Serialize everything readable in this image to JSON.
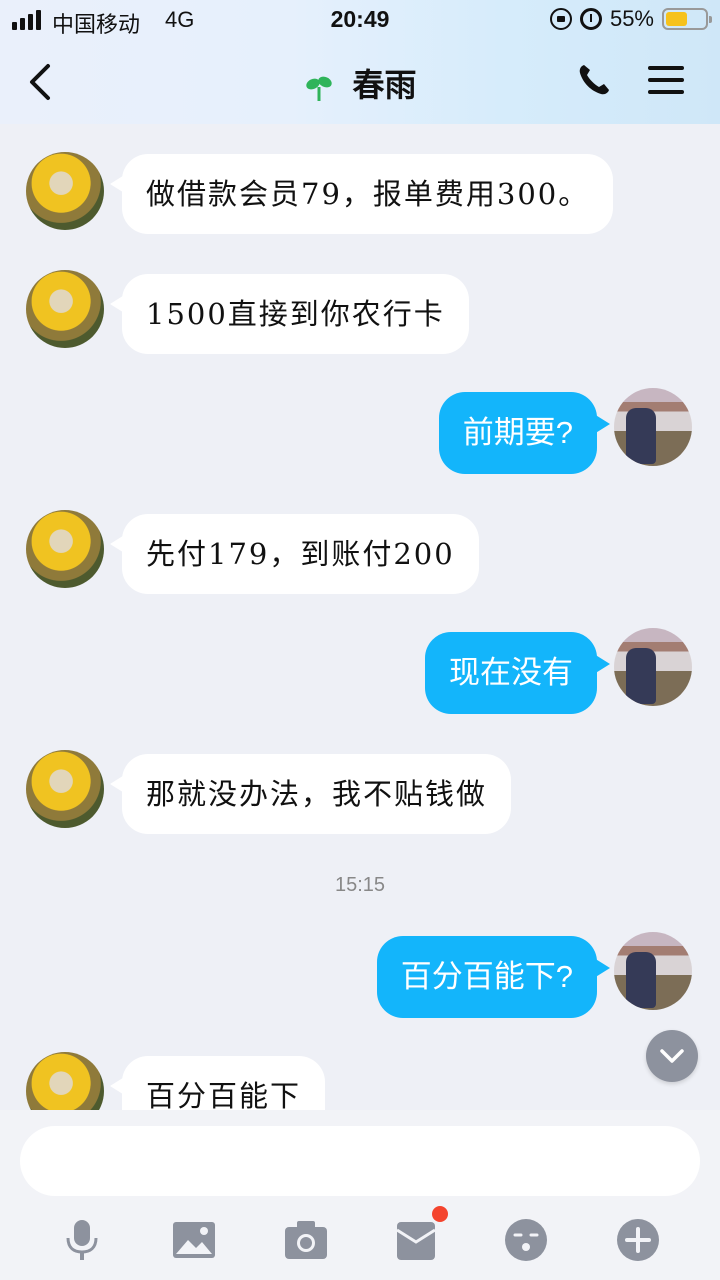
{
  "status_bar": {
    "carrier": "中国移动",
    "network": "4G",
    "time": "20:49",
    "battery_percent": "55%",
    "battery_level": 0.55
  },
  "header": {
    "title": "春雨"
  },
  "messages": [
    {
      "side": "left",
      "text": "做借款会员79，报单费用300。"
    },
    {
      "side": "left",
      "text": "1500直接到你农行卡"
    },
    {
      "side": "right",
      "text": "前期要?"
    },
    {
      "side": "left",
      "text": "先付179，到账付200"
    },
    {
      "side": "right",
      "text": "现在没有"
    },
    {
      "side": "left",
      "text": "那就没办法，我不贴钱做"
    },
    {
      "side": "right",
      "text": "百分百能下?"
    },
    {
      "side": "left",
      "text": "百分百能下"
    }
  ],
  "timestamp": "15:15",
  "input": {
    "value": "",
    "placeholder": ""
  },
  "toolbar": {
    "icons": [
      "microphone-icon",
      "image-icon",
      "camera-icon",
      "red-packet-icon",
      "emoji-icon",
      "plus-icon"
    ]
  },
  "colors": {
    "outgoing_bubble": "#13b5fb",
    "incoming_bubble": "#ffffff",
    "badge": "#f4442e",
    "battery": "#f6c21c"
  }
}
